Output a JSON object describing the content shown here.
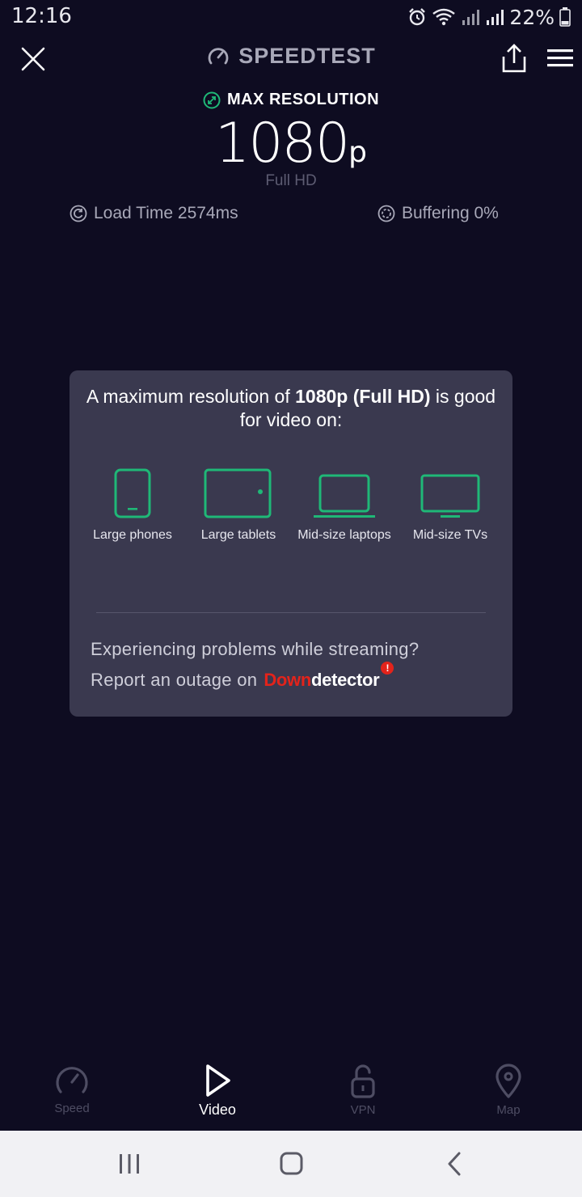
{
  "status_bar": {
    "time": "12:16",
    "battery": "22%"
  },
  "topbar": {
    "title": "SPEEDTEST"
  },
  "result": {
    "label": "MAX RESOLUTION",
    "value": "1080",
    "unit": "p",
    "quality": "Full HD",
    "load_time": "Load Time 2574ms",
    "buffering": "Buffering 0%"
  },
  "card": {
    "heading_pre": "A maximum resolution of ",
    "heading_bold": "1080p (Full HD)",
    "heading_post": " is good for video on:",
    "devices": [
      {
        "label": "Large phones",
        "icon": "phone-icon"
      },
      {
        "label": "Large tablets",
        "icon": "tablet-icon"
      },
      {
        "label": "Mid-size laptops",
        "icon": "laptop-icon"
      },
      {
        "label": "Mid-size TVs",
        "icon": "tv-icon"
      }
    ],
    "problem_text": "Experiencing problems while streaming?",
    "report_text": "Report an outage on",
    "brand_down": "Down",
    "brand_detector": "detector",
    "brand_badge": "!"
  },
  "bottom_nav": {
    "items": [
      {
        "label": "Speed",
        "icon": "speedometer-icon",
        "active": false
      },
      {
        "label": "Video",
        "icon": "play-icon",
        "active": true
      },
      {
        "label": "VPN",
        "icon": "lock-icon",
        "active": false
      },
      {
        "label": "Map",
        "icon": "map-pin-icon",
        "active": false
      }
    ]
  },
  "colors": {
    "background": "#0e0c21",
    "card": "#3a394f",
    "accent_green": "#1fb877",
    "brand_red": "#e3231b",
    "inactive": "#4e4d63"
  }
}
